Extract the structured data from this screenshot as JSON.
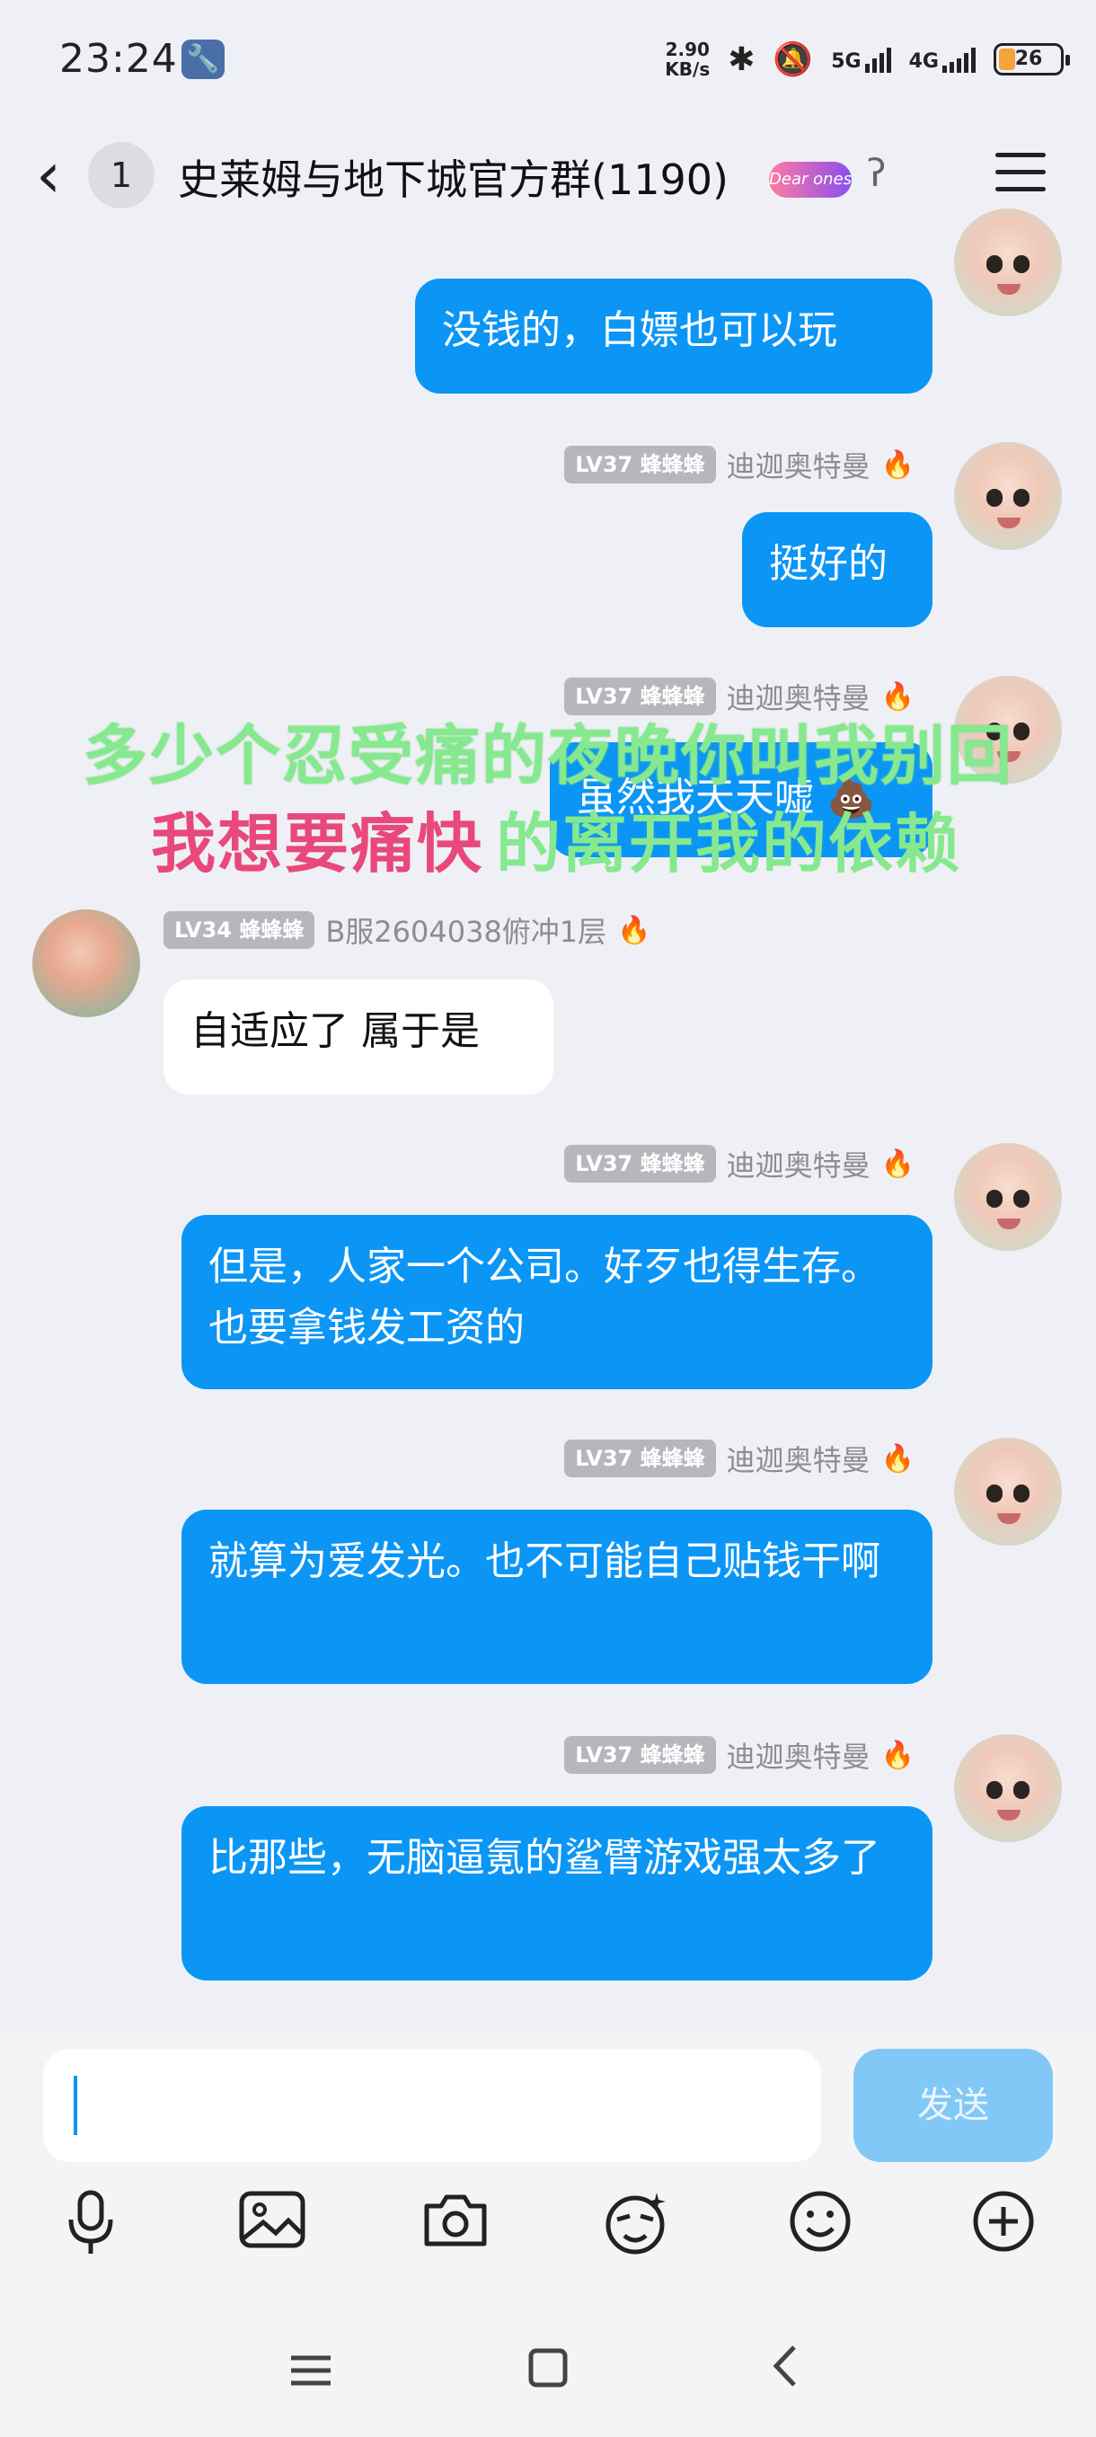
{
  "status": {
    "time": "23:24",
    "speed_value": "2.90",
    "speed_unit": "KB/s",
    "net5g": "5G",
    "net4g": "4G",
    "battery": "26"
  },
  "header": {
    "unread": "1",
    "title": "史莱姆与地下城官方群(1190)",
    "badge": "Dear ones"
  },
  "messages": [
    {
      "level": "LV37 蜂蜂蜂",
      "nick": "迪迦奥特曼",
      "text": "没钱的，白嫖也可以玩"
    },
    {
      "level": "LV37 蜂蜂蜂",
      "nick": "迪迦奥特曼",
      "text": "挺好的"
    },
    {
      "level": "LV37 蜂蜂蜂",
      "nick": "迪迦奥特曼",
      "text": "虽然我天天嘘"
    },
    {
      "level": "LV34 蜂蜂蜂",
      "nick": "B服2604038俯冲1层",
      "text": "自适应了 属于是"
    },
    {
      "level": "LV37 蜂蜂蜂",
      "nick": "迪迦奥特曼",
      "text": "但是，人家一个公司。好歹也得生存。也要拿钱发工资的"
    },
    {
      "level": "LV37 蜂蜂蜂",
      "nick": "迪迦奥特曼",
      "text": "就算为爱发光。也不可能自己贴钱干啊"
    },
    {
      "level": "LV37 蜂蜂蜂",
      "nick": "迪迦奥特曼",
      "text": "比那些，无脑逼氪的鲨臂游戏强太多了"
    }
  ],
  "overlay": {
    "line1": "多少个忍受痛的夜晚你叫我别回",
    "line2_red": "我想要痛快",
    "line2_green": "的离开我的依赖"
  },
  "input": {
    "send_label": "发送"
  },
  "icons": {
    "mic": "microphone-icon",
    "image": "image-icon",
    "camera": "camera-icon",
    "emoji": "smile-icon",
    "plus": "plus-icon"
  },
  "colors": {
    "my_bubble": "#0b96f6",
    "send_disabled": "#82c8f7",
    "overlay_green": "#86e88f",
    "overlay_red": "#e8487a"
  }
}
